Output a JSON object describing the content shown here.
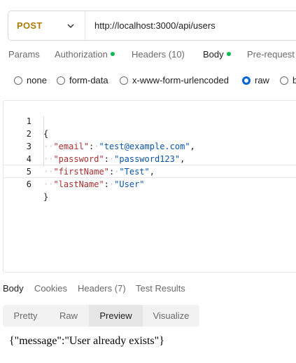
{
  "request": {
    "method": "POST",
    "url": "http://localhost:3000/api/users"
  },
  "request_tabs": {
    "params": "Params",
    "authorization": "Authorization",
    "headers": "Headers",
    "headers_count": "(10)",
    "body": "Body",
    "pre_request": "Pre-request"
  },
  "body_types": {
    "none": "none",
    "form_data": "form-data",
    "urlencoded": "x-www-form-urlencoded",
    "raw": "raw",
    "binary": "b",
    "selected": "raw"
  },
  "editor": {
    "line_numbers": [
      "1",
      "2",
      "3",
      "4",
      "5",
      "6"
    ],
    "fields": [
      {
        "key": "\"email\"",
        "value": "\"test@example.com\""
      },
      {
        "key": "\"password\"",
        "value": "\"password123\""
      },
      {
        "key": "\"firstName\"",
        "value": "\"Test\""
      },
      {
        "key": "\"lastName\"",
        "value": "\"User\""
      }
    ],
    "open_brace": "{",
    "close_brace": "}"
  },
  "response_tabs": {
    "body": "Body",
    "cookies": "Cookies",
    "headers": "Headers",
    "headers_count": "(7)",
    "test_results": "Test Results"
  },
  "response_views": {
    "pretty": "Pretty",
    "raw": "Raw",
    "preview": "Preview",
    "visualize": "Visualize",
    "selected": "Preview"
  },
  "response_body": "{\"message\":\"User already exists\"}",
  "colors": {
    "method": "#ad7a03",
    "status_dot": "#0cbb52",
    "radio_selected": "#0265d2",
    "json_key": "#a82f2f",
    "json_string": "#0a55a8"
  }
}
